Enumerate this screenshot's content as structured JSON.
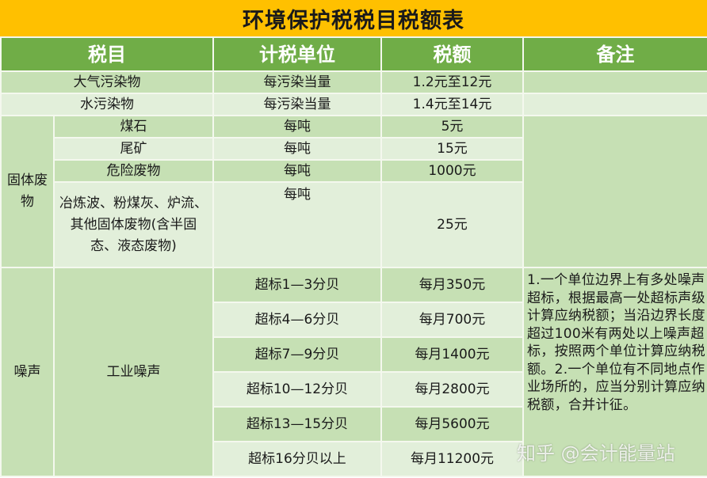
{
  "title": "环境保护税税目税额表",
  "headers": [
    "税目",
    "计税单位",
    "税额",
    "备注"
  ],
  "rows": {
    "air": {
      "item": "大气污染物",
      "unit": "每污染当量",
      "amount": "1.2元至12元"
    },
    "water": {
      "item": "水污染物",
      "unit": "每污染当量",
      "amount": "1.4元至14元"
    }
  },
  "solid": {
    "category": "固体废物",
    "items": [
      {
        "item": "煤石",
        "unit": "每吨",
        "amount": "5元"
      },
      {
        "item": "尾矿",
        "unit": "每吨",
        "amount": "15元"
      },
      {
        "item": "危险废物",
        "unit": "每吨",
        "amount": "1000元"
      },
      {
        "item": "冶炼波、粉煤灰、炉流、其他固体废物(含半固态、液态废物)",
        "unit": "每吨",
        "amount": "25元"
      }
    ]
  },
  "noise": {
    "category": "噪声",
    "subcategory": "工业噪声",
    "levels": [
      {
        "unit": "超标1—3分贝",
        "amount": "每月350元"
      },
      {
        "unit": "超标4—6分贝",
        "amount": "每月700元"
      },
      {
        "unit": "超标7—9分贝",
        "amount": "每月1400元"
      },
      {
        "unit": "超标10—12分贝",
        "amount": "每月2800元"
      },
      {
        "unit": "超标13—15分贝",
        "amount": "每月5600元"
      },
      {
        "unit": "超标16分贝以上",
        "amount": "每月11200元"
      }
    ],
    "remark": "1.一个单位边界上有多处噪声超标，根据最高一处超标声级计算应纳税额；当沿边界长度超过100米有两处以上噪声超标，按照两个单位计算应纳税额。2.一个单位有不同地点作业场所的，应当分别计算应纳税额，合并计征。"
  },
  "watermark": "知乎 @会计能量站",
  "colors": {
    "title_bg": "#ffc000",
    "header_bg": "#70ad47",
    "row_dark": "#c6e0b4",
    "row_light": "#e2efda"
  }
}
